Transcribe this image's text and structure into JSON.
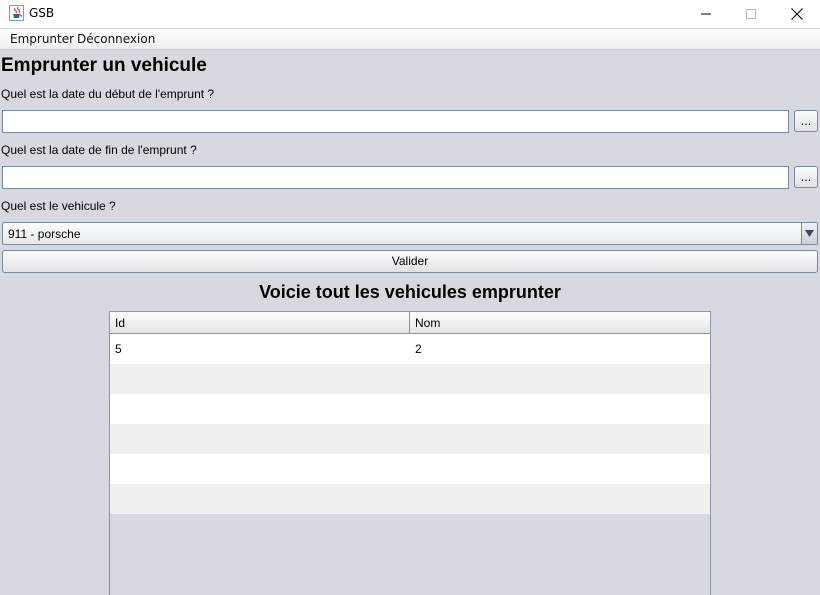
{
  "window": {
    "title": "GSB",
    "app_icon": "java-cup-icon"
  },
  "menu": {
    "items": [
      "Emprunter",
      "Déconnexion"
    ]
  },
  "form": {
    "heading": "Emprunter un vehicule",
    "start_label": "Quel est la date du début de l'emprunt ?",
    "start_value": "",
    "start_button": "...",
    "end_label": "Quel est la date de fin de l'emprunt ?",
    "end_value": "",
    "end_button": "...",
    "vehicle_label": "Quel est le vehicule ?",
    "vehicle_selected": "911 - porsche",
    "submit_label": "Valider"
  },
  "table": {
    "title": "Voicie tout les vehicules emprunter",
    "columns": [
      "Id",
      "Nom"
    ],
    "rows": [
      [
        "5",
        "2"
      ]
    ],
    "empty_rows": 5
  },
  "colors": {
    "background": "#d6d9df",
    "border": "#7a8a99",
    "row_alt": "#f0f0f0"
  }
}
